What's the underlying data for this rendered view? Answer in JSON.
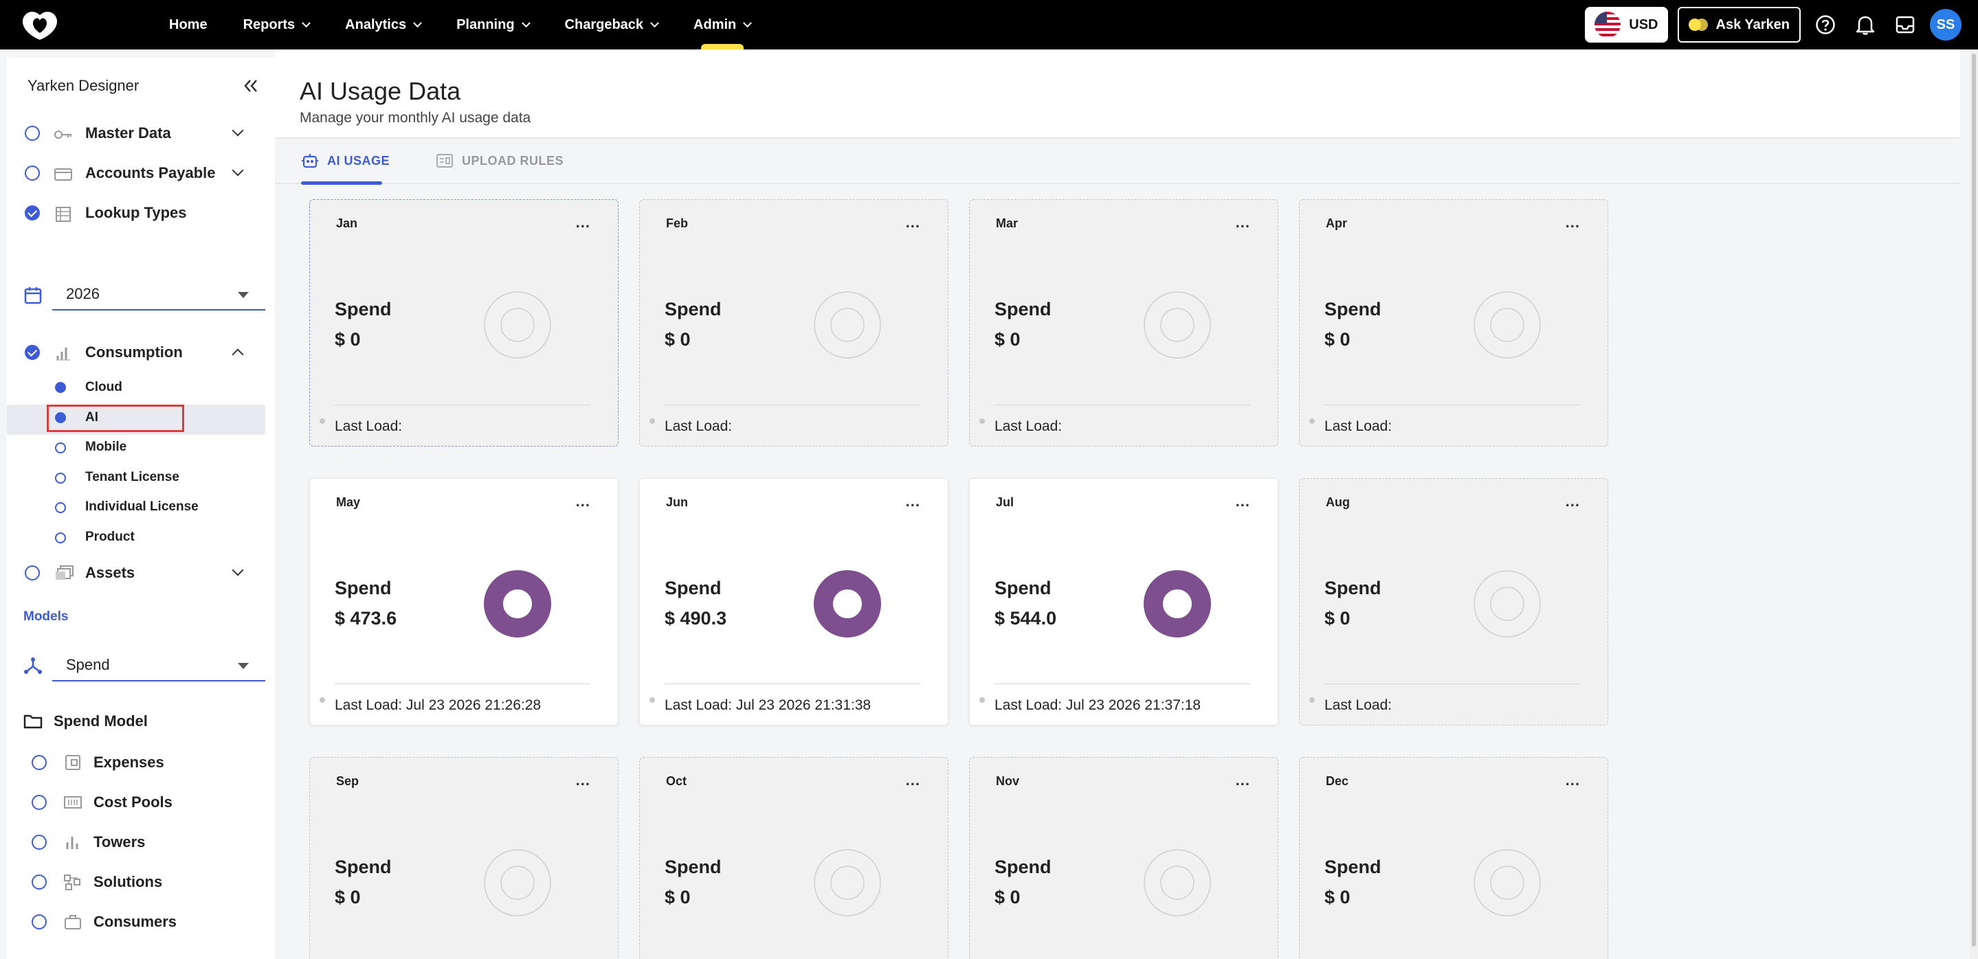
{
  "nav": {
    "items": [
      {
        "label": "Home",
        "dropdown": false
      },
      {
        "label": "Reports",
        "dropdown": true
      },
      {
        "label": "Analytics",
        "dropdown": true
      },
      {
        "label": "Planning",
        "dropdown": true
      },
      {
        "label": "Chargeback",
        "dropdown": true
      },
      {
        "label": "Admin",
        "dropdown": true
      }
    ],
    "currency": "USD",
    "ask_label": "Ask Yarken",
    "avatar_initials": "SS",
    "accent_color": "#ffe14d"
  },
  "sidebar": {
    "title": "Yarken Designer",
    "top_items": [
      {
        "label": "Master Data",
        "icon": "key-icon"
      },
      {
        "label": "Accounts Payable",
        "icon": "card-icon"
      },
      {
        "label": "Lookup Types",
        "icon": "table-icon",
        "checked": true
      }
    ],
    "year": "2026",
    "consumption_label": "Consumption",
    "consumption_items": [
      "Cloud",
      "AI",
      "Mobile",
      "Tenant License",
      "Individual License",
      "Product"
    ],
    "assets_label": "Assets",
    "models_label": "Models",
    "model_select": "Spend",
    "spend_model_label": "Spend Model",
    "model_items": [
      "Expenses",
      "Cost Pools",
      "Towers",
      "Solutions",
      "Consumers"
    ]
  },
  "page": {
    "title": "AI Usage Data",
    "subtitle": "Manage your monthly AI usage data",
    "tabs": [
      {
        "label": "AI USAGE",
        "active": true
      },
      {
        "label": "UPLOAD RULES",
        "active": false
      }
    ]
  },
  "cards": [
    {
      "month": "Jan",
      "spend_label": "Spend",
      "value": "$ 0",
      "last_load": "Last Load:",
      "has_data": false
    },
    {
      "month": "Feb",
      "spend_label": "Spend",
      "value": "$ 0",
      "last_load": "Last Load:",
      "has_data": false
    },
    {
      "month": "Mar",
      "spend_label": "Spend",
      "value": "$ 0",
      "last_load": "Last Load:",
      "has_data": false
    },
    {
      "month": "Apr",
      "spend_label": "Spend",
      "value": "$ 0",
      "last_load": "Last Load:",
      "has_data": false
    },
    {
      "month": "May",
      "spend_label": "Spend",
      "value": "$ 473.6",
      "last_load": "Last Load: Jul 23 2026 21:26:28",
      "has_data": true
    },
    {
      "month": "Jun",
      "spend_label": "Spend",
      "value": "$ 490.3",
      "last_load": "Last Load: Jul 23 2026 21:31:38",
      "has_data": true
    },
    {
      "month": "Jul",
      "spend_label": "Spend",
      "value": "$ 544.0",
      "last_load": "Last Load: Jul 23 2026 21:37:18",
      "has_data": true
    },
    {
      "month": "Aug",
      "spend_label": "Spend",
      "value": "$ 0",
      "last_load": "Last Load:",
      "has_data": false
    },
    {
      "month": "Sep",
      "spend_label": "Spend",
      "value": "$ 0",
      "last_load": "",
      "has_data": false
    },
    {
      "month": "Oct",
      "spend_label": "Spend",
      "value": "$ 0",
      "last_load": "",
      "has_data": false
    },
    {
      "month": "Nov",
      "spend_label": "Spend",
      "value": "$ 0",
      "last_load": "",
      "has_data": false
    },
    {
      "month": "Dec",
      "spend_label": "Spend",
      "value": "$ 0",
      "last_load": "",
      "has_data": false
    }
  ],
  "colors": {
    "donut_filled": "#7e4f8e",
    "primary": "#3d5bd8",
    "highlight_box": "#e23a3a"
  },
  "card_menu_label": "..."
}
